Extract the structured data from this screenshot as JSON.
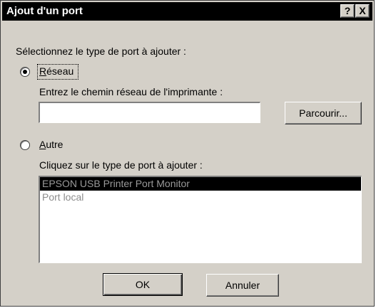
{
  "window": {
    "title": "Ajout d'un port",
    "help_label": "?",
    "close_label": "X"
  },
  "prompt": "Sélectionnez le type de port à ajouter :",
  "network": {
    "radio_label": "Réseau",
    "selected": true,
    "path_label": "Entrez le chemin réseau de l'imprimante :",
    "path_value": "",
    "browse_label": "Parcourir..."
  },
  "other": {
    "radio_label": "Autre",
    "selected": false,
    "list_label": "Cliquez sur le type de port à ajouter :",
    "port_types": [
      {
        "label": "EPSON USB Printer Port Monitor",
        "selected": true
      },
      {
        "label": "Port local",
        "selected": false
      }
    ]
  },
  "footer": {
    "ok_label": "OK",
    "cancel_label": "Annuler"
  }
}
